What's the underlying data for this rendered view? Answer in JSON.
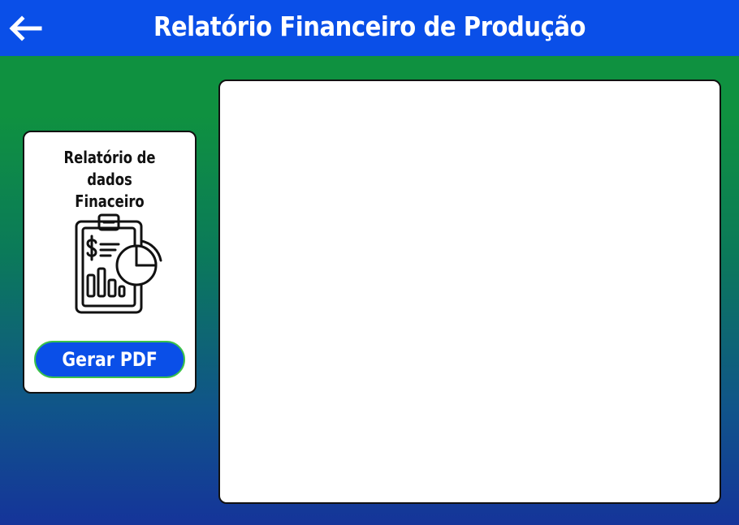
{
  "header": {
    "title": "Relatório Financeiro de Produção",
    "back_icon": "arrow-left-icon",
    "background": "#0a4fe8"
  },
  "card": {
    "title": "Relatório de dados\nFinaceiro",
    "icon": "financial-report-icon",
    "button_label": "Gerar PDF",
    "button_color": "#0a4fe8",
    "button_border": "#3bc24a"
  },
  "colors": {
    "gradient_top": "#0f9140",
    "gradient_bottom": "#15349a",
    "panel_bg": "#ffffff"
  }
}
